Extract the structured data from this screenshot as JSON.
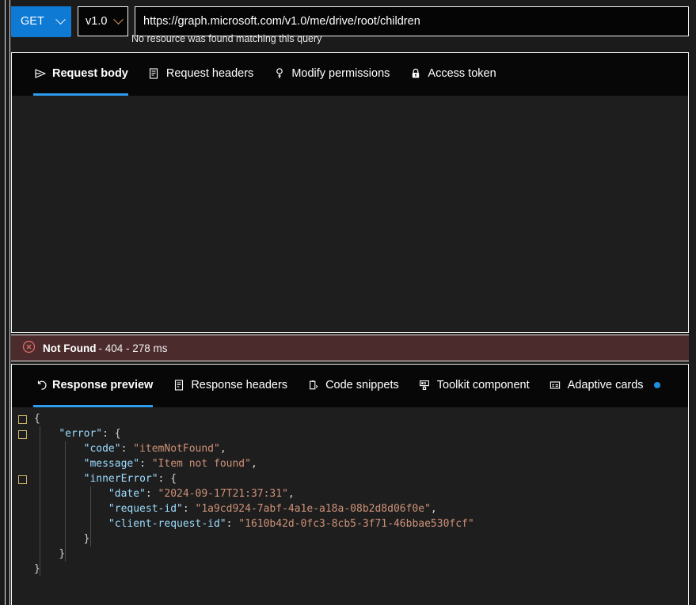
{
  "query": {
    "method": "GET",
    "version": "v1.0",
    "url": "https://graph.microsoft.com/v1.0/me/drive/root/children",
    "hint": "No resource was found matching this query"
  },
  "request_panel": {
    "tabs": [
      {
        "label": "Request body",
        "icon": "send-icon",
        "active": true
      },
      {
        "label": "Request headers",
        "icon": "document-icon",
        "active": false
      },
      {
        "label": "Modify permissions",
        "icon": "key-icon",
        "active": false
      },
      {
        "label": "Access token",
        "icon": "lock-icon",
        "active": false
      }
    ],
    "body": ""
  },
  "status": {
    "icon": "error-circle-icon",
    "title": "Not Found",
    "detail": " - 404 - 278 ms",
    "background": "#4b2b2b",
    "accent": "#e06c6c"
  },
  "response_panel": {
    "tabs": [
      {
        "label": "Response preview",
        "icon": "undo-arrow-icon",
        "active": true,
        "badge": false
      },
      {
        "label": "Response headers",
        "icon": "document-icon",
        "active": false,
        "badge": false
      },
      {
        "label": "Code snippets",
        "icon": "code-clipboard-icon",
        "active": false,
        "badge": false
      },
      {
        "label": "Toolkit component",
        "icon": "toolkit-icon",
        "active": false,
        "badge": false
      },
      {
        "label": "Adaptive cards",
        "icon": "card-icon",
        "active": false,
        "badge": true
      }
    ],
    "code_lines": [
      {
        "fold": true,
        "indent": 0,
        "text": "{"
      },
      {
        "fold": true,
        "indent": 1,
        "key": "\"error\"",
        "text": ": {"
      },
      {
        "fold": false,
        "indent": 2,
        "key": "\"code\"",
        "str": "\"itemNotFound\"",
        "text": ","
      },
      {
        "fold": false,
        "indent": 2,
        "key": "\"message\"",
        "str": "\"Item not found\"",
        "text": ","
      },
      {
        "fold": true,
        "indent": 2,
        "key": "\"innerError\"",
        "text": ": {"
      },
      {
        "fold": false,
        "indent": 3,
        "key": "\"date\"",
        "str": "\"2024-09-17T21:37:31\"",
        "text": ","
      },
      {
        "fold": false,
        "indent": 3,
        "key": "\"request-id\"",
        "str": "\"1a9cd924-7abf-4a1e-a18a-08b2d8d06f0e\"",
        "text": ","
      },
      {
        "fold": false,
        "indent": 3,
        "key": "\"client-request-id\"",
        "str": "\"1610b42d-0fc3-8cb5-3f71-46bbae530fcf\"",
        "text": ""
      },
      {
        "fold": false,
        "indent": 2,
        "text": "}"
      },
      {
        "fold": false,
        "indent": 1,
        "text": "}"
      },
      {
        "fold": false,
        "indent": 0,
        "text": "}"
      }
    ]
  },
  "colors": {
    "accent_blue": "#2d9cf0",
    "method_blue": "#0f7ad4",
    "json_key": "#9cdcfe",
    "json_string": "#ce9178",
    "editor_bg": "#1e1e1e",
    "tabstrip_bg": "#070707"
  }
}
